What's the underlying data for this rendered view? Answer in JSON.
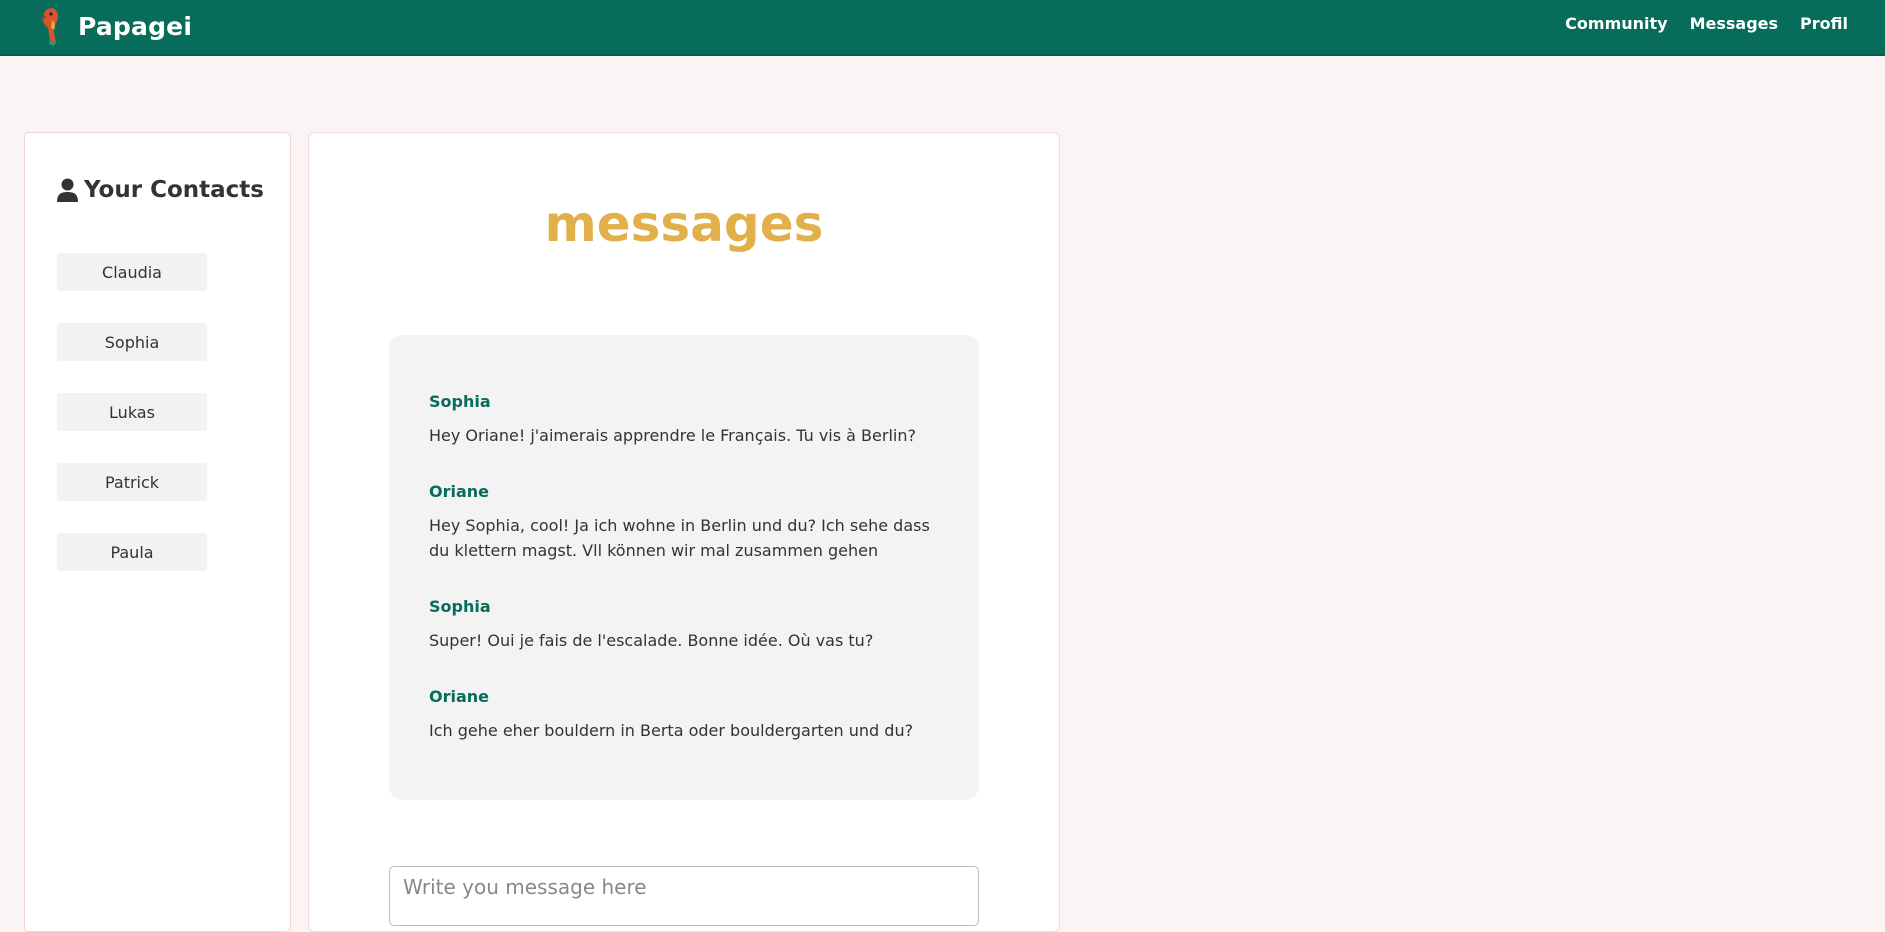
{
  "app": {
    "name": "Papagei"
  },
  "nav": {
    "community": "Community",
    "messages": "Messages",
    "profil": "Profil"
  },
  "contacts": {
    "title": "Your Contacts",
    "items": [
      "Claudia",
      "Sophia",
      "Lukas",
      "Patrick",
      "Paula"
    ]
  },
  "main": {
    "title": "messages"
  },
  "thread": {
    "messages": [
      {
        "author": "Sophia",
        "text": "Hey Oriane! j'aimerais apprendre le Français. Tu vis à Berlin?"
      },
      {
        "author": "Oriane",
        "text": "Hey Sophia, cool! Ja ich wohne in Berlin und du? Ich sehe dass du klettern magst. Vll können wir mal zusammen gehen"
      },
      {
        "author": "Sophia",
        "text": "Super! Oui je fais de l'escalade. Bonne idée. Où vas tu?"
      },
      {
        "author": "Oriane",
        "text": "Ich gehe eher bouldern in Berta oder bouldergarten und du?"
      }
    ]
  },
  "compose": {
    "placeholder": "Write you message here"
  },
  "colors": {
    "nav_bg": "#076c5a",
    "accent_title": "#e2b04a",
    "author": "#076c5a",
    "page_bg": "#faf5f4"
  },
  "icons": {
    "logo": "parrot-logo-icon",
    "contacts": "user-icon"
  }
}
